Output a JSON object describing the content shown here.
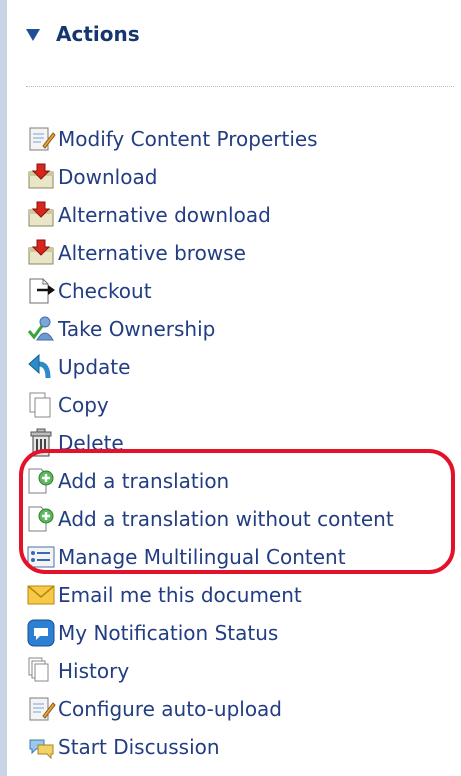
{
  "header": {
    "title": "Actions"
  },
  "actions": [
    {
      "label": "Modify Content Properties",
      "icon": "edit-properties-icon"
    },
    {
      "label": "Download",
      "icon": "download-icon"
    },
    {
      "label": "Alternative download",
      "icon": "alternative-download-icon"
    },
    {
      "label": "Alternative browse",
      "icon": "alternative-browse-icon"
    },
    {
      "label": "Checkout",
      "icon": "checkout-icon"
    },
    {
      "label": "Take Ownership",
      "icon": "take-ownership-icon"
    },
    {
      "label": "Update",
      "icon": "update-icon"
    },
    {
      "label": "Copy",
      "icon": "copy-icon"
    },
    {
      "label": "Delete",
      "icon": "delete-icon"
    },
    {
      "label": "Add a translation",
      "icon": "add-translation-icon"
    },
    {
      "label": "Add a translation without content",
      "icon": "add-translation-icon"
    },
    {
      "label": "Manage Multilingual Content",
      "icon": "multilingual-icon"
    },
    {
      "label": "Email me this document",
      "icon": "email-icon"
    },
    {
      "label": "My Notification Status",
      "icon": "notification-icon"
    },
    {
      "label": "History",
      "icon": "history-icon"
    },
    {
      "label": "Configure auto-upload",
      "icon": "configure-icon"
    },
    {
      "label": "Start Discussion",
      "icon": "discussion-icon"
    }
  ],
  "annotation": {
    "color": "#e3122a",
    "highlighted": [
      "Add a translation",
      "Add a translation without content",
      "Manage Multilingual Content"
    ]
  },
  "colors": {
    "link": "#223d82",
    "title": "#16376e",
    "accent": "#1f4f96"
  }
}
